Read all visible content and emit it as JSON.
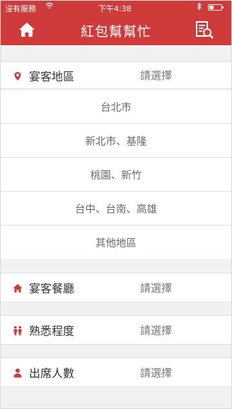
{
  "status_bar": {
    "carrier": "沒有服務",
    "time": "下午4:38",
    "battery_level": 0.35
  },
  "nav": {
    "title": "紅包幫幫忙",
    "home_icon": "home-icon",
    "search_icon": "document-search-icon"
  },
  "colors": {
    "brand_red": "#cf3b3b"
  },
  "venue_region": {
    "label": "宴客地區",
    "value": "請選擇",
    "icon": "location-pin-icon",
    "options": [
      "台北市",
      "新北市、基隆",
      "桃園、新竹",
      "台中、台南、高雄",
      "其他地區"
    ]
  },
  "restaurant": {
    "label": "宴客餐廳",
    "value": "請選擇",
    "icon": "home-icon"
  },
  "familiarity": {
    "label": "熟悉程度",
    "value": "請選擇",
    "icon": "people-icon"
  },
  "attendees": {
    "label": "出席人數",
    "value": "請選擇",
    "icon": "person-icon"
  }
}
